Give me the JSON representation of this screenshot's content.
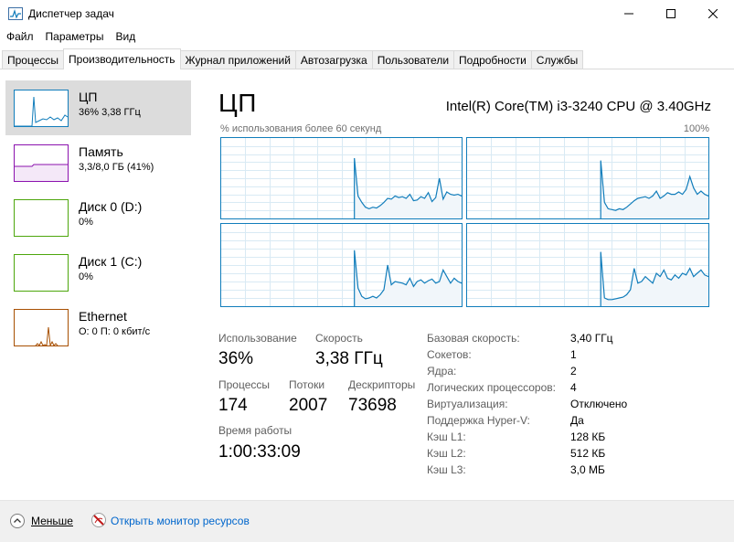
{
  "window": {
    "title": "Диспетчер задач"
  },
  "menu": [
    "Файл",
    "Параметры",
    "Вид"
  ],
  "tabs": [
    "Процессы",
    "Производительность",
    "Журнал приложений",
    "Автозагрузка",
    "Пользователи",
    "Подробности",
    "Службы"
  ],
  "active_tab": "Производительность",
  "sidebar": [
    {
      "title": "ЦП",
      "sub": "36% 3,38 ГГц",
      "color": "#117dbb",
      "selected": true
    },
    {
      "title": "Память",
      "sub": "3,3/8,0 ГБ (41%)",
      "color": "#8b12ae",
      "selected": false
    },
    {
      "title": "Диск 0 (D:)",
      "sub": "0%",
      "color": "#4da60c",
      "selected": false
    },
    {
      "title": "Диск 1 (C:)",
      "sub": "0%",
      "color": "#4da60c",
      "selected": false
    },
    {
      "title": "Ethernet",
      "sub": "О: 0 П: 0 кбит/с",
      "color": "#a74f01",
      "selected": false
    }
  ],
  "main": {
    "title": "ЦП",
    "cpu_model": "Intel(R) Core(TM) i3-3240 CPU @ 3.40GHz",
    "graph_label": "% использования более 60 секунд",
    "graph_max": "100%",
    "accent": "#117dbb",
    "graph_fill": "#f1f6fa"
  },
  "stats": {
    "usage_label": "Использование",
    "usage_value": "36%",
    "speed_label": "Скорость",
    "speed_value": "3,38 ГГц",
    "processes_label": "Процессы",
    "processes_value": "174",
    "threads_label": "Потоки",
    "threads_value": "2007",
    "handles_label": "Дескрипторы",
    "handles_value": "73698",
    "uptime_label": "Время работы",
    "uptime_value": "1:00:33:09"
  },
  "details": [
    {
      "label": "Базовая скорость:",
      "value": "3,40 ГГц"
    },
    {
      "label": "Сокетов:",
      "value": "1"
    },
    {
      "label": "Ядра:",
      "value": "2"
    },
    {
      "label": "Логических процессоров:",
      "value": "4"
    },
    {
      "label": "Виртуализация:",
      "value": "Отключено"
    },
    {
      "label": "Поддержка Hyper-V:",
      "value": "Да"
    },
    {
      "label": "Кэш L1:",
      "value": "128 КБ"
    },
    {
      "label": "Кэш L2:",
      "value": "512 КБ"
    },
    {
      "label": "Кэш L3:",
      "value": "3,0 МБ"
    }
  ],
  "footer": {
    "less_label": "Меньше",
    "resmon_label": "Открыть монитор ресурсов"
  },
  "cpu_history": [
    [
      0,
      0,
      0,
      0,
      0,
      0,
      0,
      0,
      0,
      0,
      0,
      0,
      0,
      0,
      0,
      0,
      0,
      0,
      0,
      0,
      0,
      0,
      0,
      0,
      0,
      0,
      0,
      0,
      0,
      0,
      0,
      0,
      0,
      0,
      0,
      0,
      75,
      28,
      20,
      14,
      12,
      14,
      13,
      16,
      20,
      25,
      24,
      28,
      26,
      27,
      25,
      30,
      22,
      23,
      27,
      25,
      32,
      21,
      26,
      50,
      24,
      33,
      30,
      29,
      30,
      28
    ],
    [
      0,
      0,
      0,
      0,
      0,
      0,
      0,
      0,
      0,
      0,
      0,
      0,
      0,
      0,
      0,
      0,
      0,
      0,
      0,
      0,
      0,
      0,
      0,
      0,
      0,
      0,
      0,
      0,
      0,
      0,
      0,
      0,
      0,
      0,
      0,
      0,
      72,
      20,
      12,
      11,
      10,
      12,
      11,
      14,
      18,
      22,
      25,
      26,
      27,
      25,
      28,
      34,
      25,
      28,
      32,
      30,
      30,
      33,
      30,
      36,
      52,
      38,
      30,
      34,
      30,
      28
    ],
    [
      0,
      0,
      0,
      0,
      0,
      0,
      0,
      0,
      0,
      0,
      0,
      0,
      0,
      0,
      0,
      0,
      0,
      0,
      0,
      0,
      0,
      0,
      0,
      0,
      0,
      0,
      0,
      0,
      0,
      0,
      0,
      0,
      0,
      0,
      0,
      0,
      68,
      22,
      12,
      9,
      10,
      12,
      10,
      14,
      20,
      50,
      26,
      30,
      29,
      28,
      26,
      34,
      24,
      30,
      32,
      28,
      31,
      33,
      28,
      30,
      44,
      36,
      28,
      34,
      30,
      28
    ],
    [
      0,
      0,
      0,
      0,
      0,
      0,
      0,
      0,
      0,
      0,
      0,
      0,
      0,
      0,
      0,
      0,
      0,
      0,
      0,
      0,
      0,
      0,
      0,
      0,
      0,
      0,
      0,
      0,
      0,
      0,
      0,
      0,
      0,
      0,
      0,
      0,
      66,
      10,
      8,
      8,
      9,
      10,
      11,
      14,
      20,
      46,
      28,
      30,
      36,
      32,
      28,
      40,
      36,
      44,
      34,
      32,
      38,
      34,
      40,
      38,
      46,
      36,
      40,
      44,
      38,
      36
    ]
  ]
}
